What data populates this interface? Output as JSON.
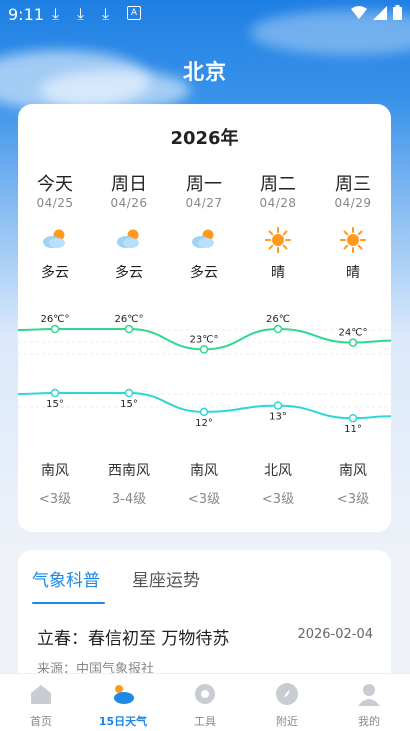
{
  "status_bar": {
    "time": "9:11"
  },
  "header": {
    "city": "北京"
  },
  "forecast": {
    "year": "2026年",
    "days": [
      {
        "name": "今天",
        "date": "04/25",
        "icon": "partly-cloudy-icon",
        "condition": "多云",
        "high": "26℃°",
        "low": "15°",
        "wind": "南风",
        "level": "<3级"
      },
      {
        "name": "周日",
        "date": "04/26",
        "icon": "partly-cloudy-icon",
        "condition": "多云",
        "high": "26℃°",
        "low": "15°",
        "wind": "西南风",
        "level": "3-4级"
      },
      {
        "name": "周一",
        "date": "04/27",
        "icon": "partly-cloudy-icon",
        "condition": "多云",
        "high": "23℃°",
        "low": "12°",
        "wind": "南风",
        "level": "<3级"
      },
      {
        "name": "周二",
        "date": "04/28",
        "icon": "sunny-icon",
        "condition": "晴",
        "high": "26℃",
        "low": "13°",
        "wind": "北风",
        "level": "<3级"
      },
      {
        "name": "周三",
        "date": "04/29",
        "icon": "sunny-icon",
        "condition": "晴",
        "high": "24℃°",
        "low": "11°",
        "wind": "南风",
        "level": "<3级"
      }
    ]
  },
  "chart_data": {
    "type": "line",
    "categories": [
      "04/25",
      "04/26",
      "04/27",
      "04/28",
      "04/29"
    ],
    "series": [
      {
        "values": [
          26,
          26,
          23,
          26,
          24
        ],
        "color": "#2ed88f"
      },
      {
        "values": [
          15,
          15,
          12,
          13,
          11
        ],
        "color": "#2fd6d6"
      }
    ]
  },
  "articles": {
    "tabs": [
      "气象科普",
      "星座运势"
    ],
    "title": "立春：春信初至 万物待苏",
    "date": "2026-02-04",
    "source": "来源：中国气象报社"
  },
  "bottom_nav": {
    "items": [
      {
        "label": "首页",
        "icon": "home-icon"
      },
      {
        "label": "15日天气",
        "icon": "weather-icon"
      },
      {
        "label": "工具",
        "icon": "gear-icon"
      },
      {
        "label": "附近",
        "icon": "compass-icon"
      },
      {
        "label": "我的",
        "icon": "user-icon"
      }
    ]
  },
  "colors": {
    "accent": "#1e88e5",
    "high_line": "#2ed88f",
    "low_line": "#2fd6d6",
    "sun": "#ff9a1f"
  }
}
